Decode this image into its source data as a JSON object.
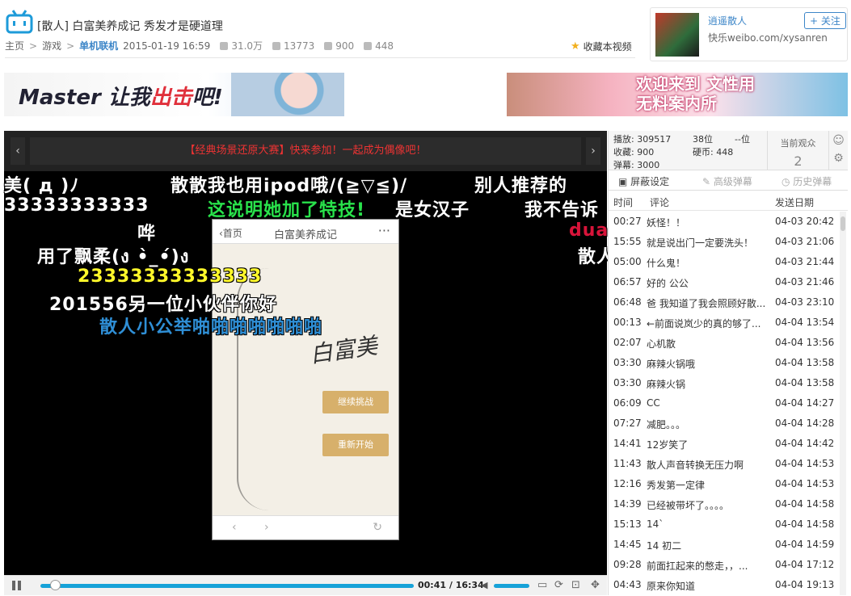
{
  "header": {
    "title": "[散人] 白富美养成记 秀发才是硬道理",
    "crumbs": [
      "主页",
      "游戏",
      "单机联机"
    ],
    "date": "2015-01-19 16:59",
    "views": "31.0万",
    "danmaku_count": "13773",
    "coins": "900",
    "favs": "448",
    "fav_label": "收藏本视频"
  },
  "uploader": {
    "name": "逍遥散人",
    "follow_label": "+ 关注",
    "url": "快乐weibo.com/xysanren"
  },
  "banners": {
    "left_a": "Master 让我",
    "left_b": "出击",
    "left_c": "吧!",
    "right_a": "欢迎来到 文性用",
    "right_b": "无料案内所"
  },
  "player": {
    "notice": "【经典场景还原大赛】快来参加！一起成为偶像吧！",
    "prev": "‹",
    "next": "›",
    "current_time": "00:41",
    "total_time": "16:34",
    "progress": 0.04,
    "phone": {
      "back": "‹首页",
      "title": "白富美养成记",
      "more": "···",
      "logo": "白富美",
      "btn1": "继续挑战",
      "btn2": "重新开始"
    },
    "danmaku": [
      {
        "text": "美(  д  )ﾉ",
        "color": "#ffffff"
      },
      {
        "text": "散散我也用ipod哦/(≧▽≦)/",
        "color": "#ffffff"
      },
      {
        "text": "别人推荐的",
        "color": "#ffffff"
      },
      {
        "text": "33333333333",
        "color": "#ffffff"
      },
      {
        "text": "这说明她加了特技!",
        "color": "#29e24b"
      },
      {
        "text": "是女汉子",
        "color": "#ffffff"
      },
      {
        "text": "我不告诉",
        "color": "#ffffff"
      },
      {
        "text": "哗",
        "color": "#ffffff"
      },
      {
        "text": "duan",
        "color": "#d8143a"
      },
      {
        "text": "用了飘柔(ง •̀_•́)ง",
        "color": "#ffffff"
      },
      {
        "text": "散人",
        "color": "#ffffff"
      },
      {
        "text": "23333333333333",
        "color": "#fff82a"
      },
      {
        "text": "201556另一位小伙伴你好",
        "color": "#ffffff"
      },
      {
        "text": "散人小公举啪啪啪啪啪啪啪",
        "color": "#2f8fd6"
      }
    ]
  },
  "side": {
    "stats": {
      "play": "播放: 309517",
      "fav": "收藏: 900",
      "danmaku": "弹幕: 3000",
      "rank": "38位",
      "rank2": "--位",
      "coin": "硬币: 448",
      "watching_label": "当前观众",
      "watching": "2"
    },
    "tabs": [
      "屏蔽设定",
      "高级弹幕",
      "历史弹幕"
    ],
    "columns": [
      "时间",
      "评论",
      "发送日期"
    ],
    "rows": [
      {
        "t": "00:27",
        "c": "妖怪！！",
        "d": "04-03 20:42"
      },
      {
        "t": "15:55",
        "c": "就是说出门一定要洗头！",
        "d": "04-03 21:06"
      },
      {
        "t": "05:00",
        "c": "什么鬼！",
        "d": "04-03 21:44"
      },
      {
        "t": "06:57",
        "c": "好的 公公",
        "d": "04-03 21:46"
      },
      {
        "t": "06:48",
        "c": "爸 我知道了我会照顾好散...",
        "d": "04-03 23:10"
      },
      {
        "t": "00:13",
        "c": "←前面说岚少的真的够了...",
        "d": "04-04 13:54"
      },
      {
        "t": "02:07",
        "c": "心机散",
        "d": "04-04 13:56"
      },
      {
        "t": "03:30",
        "c": "麻辣火锅哦",
        "d": "04-04 13:58"
      },
      {
        "t": "03:30",
        "c": "麻辣火锅",
        "d": "04-04 13:58"
      },
      {
        "t": "06:09",
        "c": "CC",
        "d": "04-04 14:27"
      },
      {
        "t": "07:27",
        "c": "减肥。。。",
        "d": "04-04 14:28"
      },
      {
        "t": "14:41",
        "c": "12岁笑了",
        "d": "04-04 14:42"
      },
      {
        "t": "11:43",
        "c": "散人声音转换无压力啊",
        "d": "04-04 14:53"
      },
      {
        "t": "12:16",
        "c": "秀发第一定律",
        "d": "04-04 14:53"
      },
      {
        "t": "14:39",
        "c": "已经被带坏了。。。。",
        "d": "04-04 14:58"
      },
      {
        "t": "15:13",
        "c": "14`",
        "d": "04-04 14:58"
      },
      {
        "t": "14:45",
        "c": "14 初二",
        "d": "04-04 14:59"
      },
      {
        "t": "09:28",
        "c": "前面扛起来的憋走，，...",
        "d": "04-04 17:12"
      },
      {
        "t": "04:43",
        "c": "原来你知道",
        "d": "04-04 19:13"
      }
    ]
  }
}
